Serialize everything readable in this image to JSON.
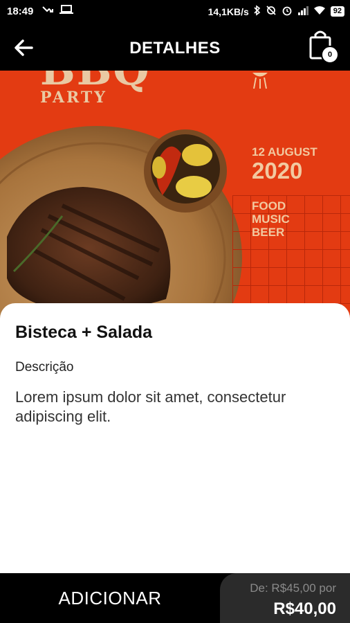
{
  "status_bar": {
    "time": "18:49",
    "network_speed": "14,1KB/s",
    "battery": "92"
  },
  "app_bar": {
    "title": "DETALHES",
    "cart_count": "0"
  },
  "hero": {
    "brand_big": "BBQ",
    "brand_small": "PARTY",
    "date_line1": "12 AUGUST",
    "date_line2": "2020",
    "tags": [
      "FOOD",
      "MUSIC",
      "BEER"
    ],
    "colors": {
      "background": "#e33b12",
      "text": "#f2c9a0"
    }
  },
  "product": {
    "name": "Bisteca + Salada",
    "description_label": "Descrição",
    "description": "Lorem ipsum dolor sit amet, consectetur adipiscing elit."
  },
  "footer": {
    "add_label": "ADICIONAR",
    "old_price": "De: R$45,00 por",
    "new_price": "R$40,00"
  }
}
